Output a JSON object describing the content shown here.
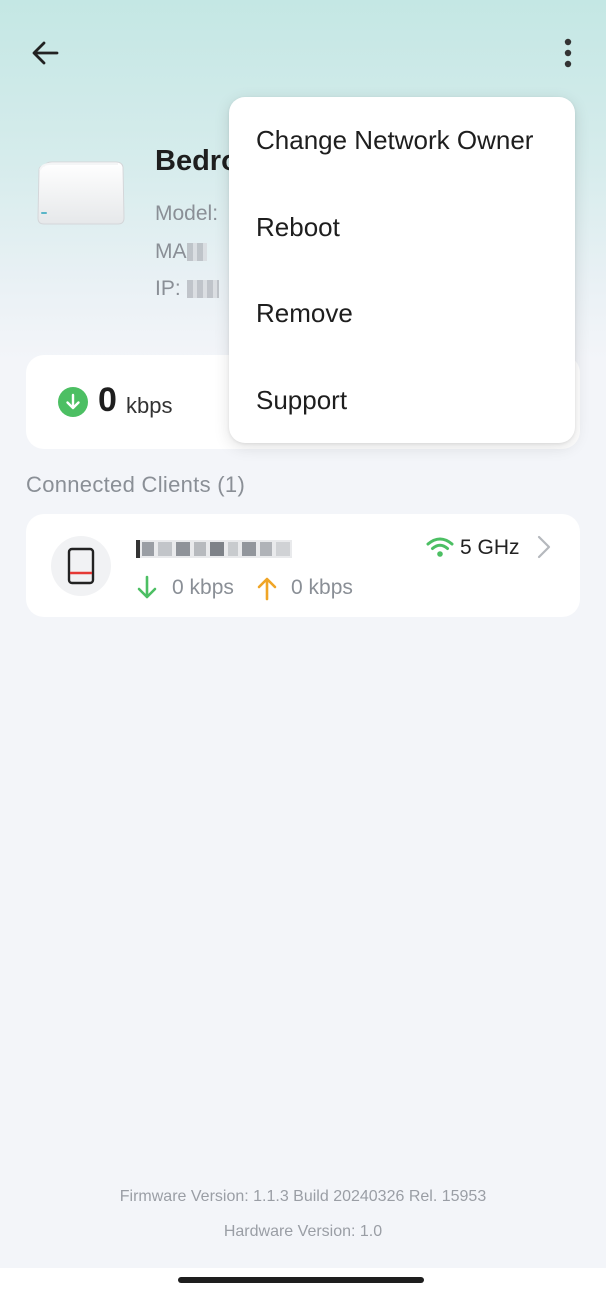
{
  "device": {
    "name": "Bedro",
    "model_label": "Model:",
    "mac_label": "MA",
    "ip_label": "IP:"
  },
  "speed": {
    "value": "0",
    "unit": "kbps"
  },
  "clients": {
    "section_title": "Connected Clients (1)",
    "items": [
      {
        "band": "5 GHz",
        "download": "0 kbps",
        "upload": "0 kbps",
        "icon": "phone-icon"
      }
    ]
  },
  "menu": {
    "items": [
      "Change Network Owner",
      "Reboot",
      "Remove",
      "Support"
    ]
  },
  "footer": {
    "firmware": "Firmware Version: 1.1.3 Build 20240326 Rel. 15953",
    "hardware": "Hardware Version: 1.0"
  },
  "colors": {
    "download_green": "#4cbf63",
    "upload_orange": "#f0a526",
    "wifi_green": "#4cbf63"
  }
}
